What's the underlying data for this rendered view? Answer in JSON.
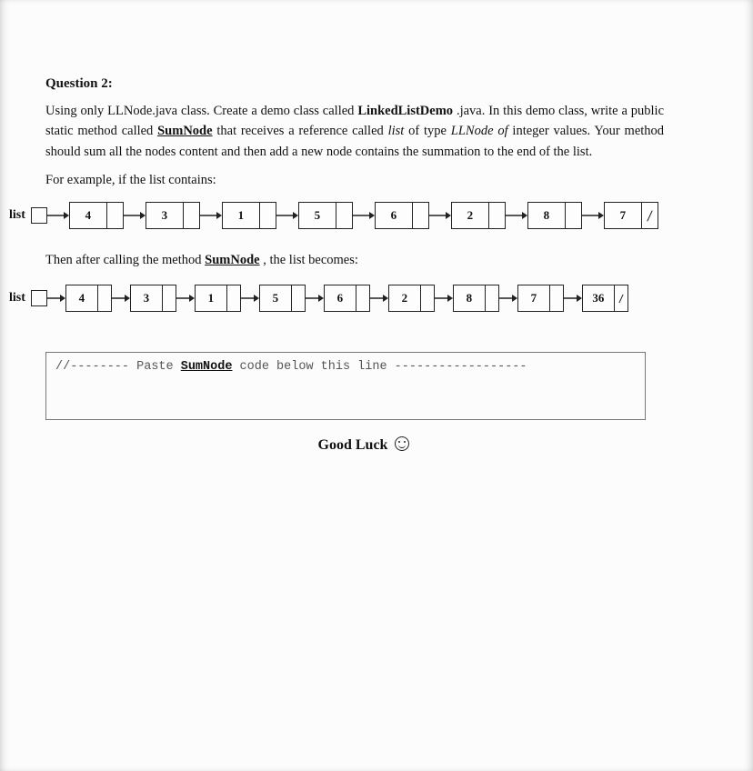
{
  "question": {
    "label": "Question 2:",
    "p1a": "Using only LLNode.java class. Create a demo class called ",
    "p1b_bold": "LinkedListDemo",
    "p1c": ".java.  In this demo class, write a public static method called ",
    "p1d_sum": "SumNode",
    "p1e": " that receives a reference called ",
    "p1f_list": "list",
    "p1g": " of type ",
    "p1h_ll": "LLNode of",
    "p1i": " integer values.  Your method should sum all the nodes content and then add a new node contains the summation to the end of the list.",
    "example": "For example,  if the list contains:",
    "then_a": "Then after calling the method ",
    "then_b_sum": "SumNode",
    "then_c": ", the list becomes:"
  },
  "list1": {
    "label": "list",
    "values": [
      "4",
      "3",
      "1",
      "5",
      "6",
      "2",
      "8",
      "7"
    ]
  },
  "list2": {
    "label": "list",
    "values": [
      "4",
      "3",
      "1",
      "5",
      "6",
      "2",
      "8",
      "7",
      "36"
    ]
  },
  "code_box": {
    "pre": "//-------- Paste ",
    "sum": "SumNode",
    "post": " code below this line ------------------"
  },
  "footer": {
    "good_luck": "Good Luck"
  }
}
